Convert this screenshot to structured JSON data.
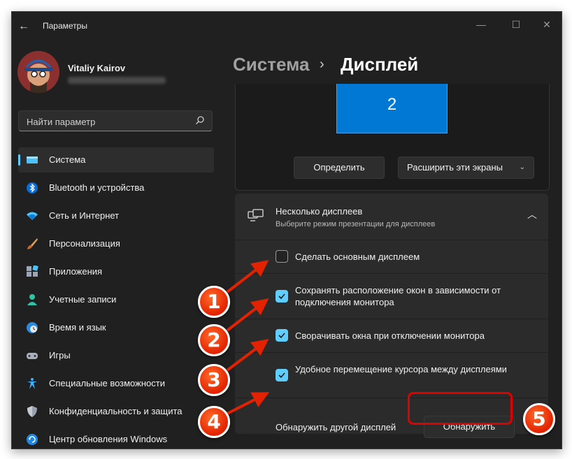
{
  "window": {
    "app_title": "Параметры",
    "min_symbol": "—",
    "max_symbol": "☐",
    "close_symbol": "✕",
    "back_symbol": "←"
  },
  "user": {
    "name": "Vitaliy Kairov"
  },
  "search": {
    "placeholder": "Найти параметр",
    "icon": "search-icon"
  },
  "sidebar": {
    "items": [
      {
        "label": "Система",
        "icon": "display-icon",
        "active": true
      },
      {
        "label": "Bluetooth и устройства",
        "icon": "bluetooth-icon"
      },
      {
        "label": "Сеть и Интернет",
        "icon": "wifi-icon"
      },
      {
        "label": "Персонализация",
        "icon": "brush-icon"
      },
      {
        "label": "Приложения",
        "icon": "apps-icon"
      },
      {
        "label": "Учетные записи",
        "icon": "person-icon"
      },
      {
        "label": "Время и язык",
        "icon": "clock-globe-icon"
      },
      {
        "label": "Игры",
        "icon": "gamepad-icon"
      },
      {
        "label": "Специальные возможности",
        "icon": "accessibility-icon"
      },
      {
        "label": "Конфиденциальность и защита",
        "icon": "shield-icon"
      },
      {
        "label": "Центр обновления Windows",
        "icon": "update-icon"
      }
    ]
  },
  "breadcrumb": {
    "parent": "Система",
    "separator": "›",
    "current": "Дисплей"
  },
  "display_arrangement": {
    "monitor_number": "2",
    "identify_label": "Определить",
    "extend_label": "Расширить эти экраны"
  },
  "multiple_displays": {
    "title": "Несколько дисплеев",
    "subtitle": "Выберите режим презентации для дисплеев",
    "options": [
      {
        "label": "Сделать основным дисплеем",
        "checked": false
      },
      {
        "label": "Сохранять расположение окон в зависимости от подключения монитора",
        "checked": true
      },
      {
        "label": "Сворачивать окна при отключении монитора",
        "checked": true
      },
      {
        "label": "Удобное перемещение курсора между дисплеями",
        "checked": true
      }
    ],
    "detect_label": "Обнаружить другой дисплей",
    "detect_button": "Обнаружить"
  },
  "annotations": {
    "badges": [
      "1",
      "2",
      "3",
      "4",
      "5"
    ],
    "color": "#e22200"
  },
  "colors": {
    "accent": "#60cdff",
    "monitor": "#0078d4",
    "background": "#202020"
  }
}
